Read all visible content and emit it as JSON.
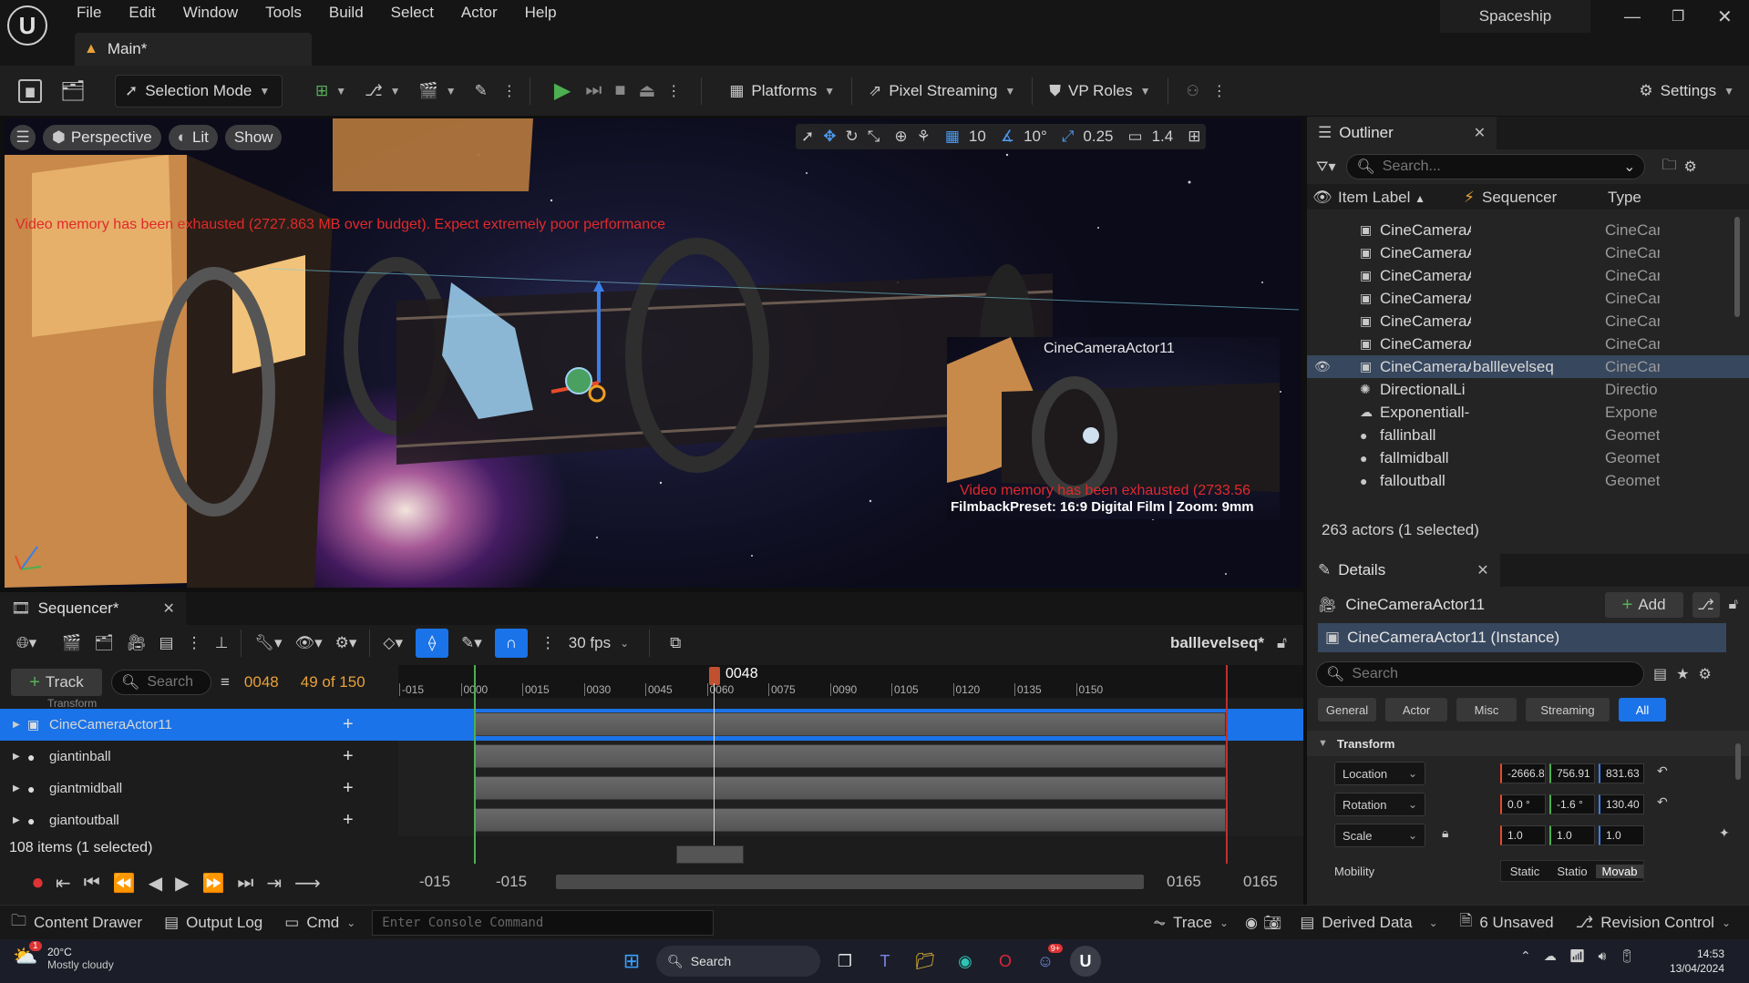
{
  "app": {
    "project_name": "Spaceship",
    "tab_title": "Main*",
    "menu": [
      "File",
      "Edit",
      "Window",
      "Tools",
      "Build",
      "Select",
      "Actor",
      "Help"
    ]
  },
  "toolbar": {
    "selection_mode": "Selection Mode",
    "platforms": "Platforms",
    "pixel_streaming": "Pixel Streaming",
    "vp_roles": "VP Roles",
    "settings": "Settings"
  },
  "viewport": {
    "perspective": "Perspective",
    "lit": "Lit",
    "show": "Show",
    "grid_snap": "10",
    "rot_snap": "10°",
    "scale_snap": "0.25",
    "camera_speed": "1.4",
    "warning": "Video memory has been exhausted (2727.863 MB over budget). Expect extremely poor performance",
    "pip": {
      "title": "CineCameraActor11",
      "warning": "Video memory has been exhausted (2733.56",
      "filmback": "FilmbackPreset: 16:9 Digital Film | Zoom: 9mm"
    }
  },
  "outliner": {
    "tab": "Outliner",
    "search_placeholder": "Search...",
    "col_label": "Item Label",
    "col_sequencer": "Sequencer",
    "col_type": "Type",
    "rows": [
      {
        "label": "CineCameraA",
        "seq": "",
        "type": "CineCar",
        "icon": "camera"
      },
      {
        "label": "CineCameraA",
        "seq": "",
        "type": "CineCar",
        "icon": "camera"
      },
      {
        "label": "CineCameraA",
        "seq": "",
        "type": "CineCar",
        "icon": "camera"
      },
      {
        "label": "CineCameraA",
        "seq": "",
        "type": "CineCar",
        "icon": "camera"
      },
      {
        "label": "CineCameraA",
        "seq": "",
        "type": "CineCar",
        "icon": "camera"
      },
      {
        "label": "CineCameraA",
        "seq": "",
        "type": "CineCar",
        "icon": "camera"
      },
      {
        "label": "CineCameraA",
        "seq": "balllevelseq",
        "type": "CineCar",
        "icon": "camera"
      },
      {
        "label": "DirectionalLi",
        "seq": "",
        "type": "Directio",
        "icon": "light"
      },
      {
        "label": "Exponentiall-",
        "seq": "",
        "type": "Expone",
        "icon": "fog"
      },
      {
        "label": "fallinball",
        "seq": "",
        "type": "Geomet",
        "icon": "geo"
      },
      {
        "label": "fallmidball",
        "seq": "",
        "type": "Geomet",
        "icon": "geo"
      },
      {
        "label": "falloutball",
        "seq": "",
        "type": "Geomet",
        "icon": "geo"
      }
    ],
    "selected_index": 6,
    "count": "263 actors (1 selected)"
  },
  "details": {
    "tab": "Details",
    "actor_name": "CineCameraActor11",
    "add_label": "Add",
    "instance": "CineCameraActor11 (Instance)",
    "search_placeholder": "Search",
    "filters": [
      "General",
      "Actor",
      "Misc",
      "Streaming",
      "All"
    ],
    "active_filter": "All",
    "section": "Transform",
    "location_label": "Location",
    "rotation_label": "Rotation",
    "scale_label": "Scale",
    "location": [
      "-2666.8",
      "756.91",
      "831.63"
    ],
    "rotation": [
      "0.0 °",
      "-1.6 °",
      "130.40"
    ],
    "scale": [
      "1.0",
      "1.0",
      "1.0"
    ],
    "mobility_label": "Mobility",
    "mobility": [
      "Static",
      "Statio",
      "Movab"
    ]
  },
  "sequencer": {
    "tab": "Sequencer*",
    "fps": "30 fps",
    "sequence_name": "balllevelseq*",
    "track_btn": "Track",
    "search_placeholder": "Search",
    "current_frame": "0048",
    "frame_count": "49 of 150",
    "playhead_label": "0048",
    "ticks": [
      "-015",
      "0000",
      "0015",
      "0030",
      "0045",
      "0060",
      "0075",
      "0090",
      "0105",
      "0120",
      "0135",
      "0150"
    ],
    "partial_row": "Transform",
    "tracks": [
      "CineCameraActor11",
      "giantinball",
      "giantmidball",
      "giantoutball"
    ],
    "items_count": "108 items (1 selected)",
    "range_start_a": "-015",
    "range_start_b": "-015",
    "range_end_a": "0165",
    "range_end_b": "0165"
  },
  "statusbar": {
    "content_drawer": "Content Drawer",
    "output_log": "Output Log",
    "cmd": "Cmd",
    "console_placeholder": "Enter Console Command",
    "trace": "Trace",
    "derived_data": "Derived Data",
    "unsaved": "6 Unsaved",
    "revision_control": "Revision Control"
  },
  "taskbar": {
    "weather_temp": "20°C",
    "weather_desc": "Mostly cloudy",
    "weather_badge": "1",
    "search": "Search",
    "time": "14:53",
    "date": "13/04/2024",
    "discord_badge": "9+"
  },
  "colors": {
    "accent": "#1a73e8",
    "warning": "#e02a2a",
    "selected_row": "#37475e",
    "play_green": "#4caf50",
    "frame_orange": "#e8a13a"
  }
}
